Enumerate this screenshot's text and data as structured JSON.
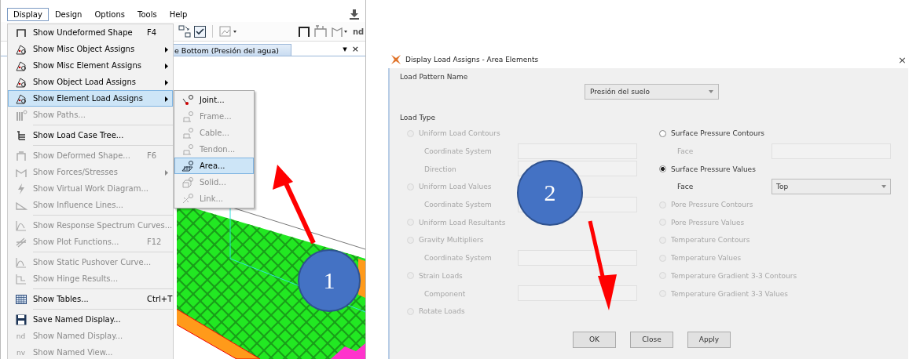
{
  "left_window": {
    "menu_bar": [
      {
        "label": "Display",
        "selected": true
      },
      {
        "label": "Design",
        "selected": false
      },
      {
        "label": "Options",
        "selected": false
      },
      {
        "label": "Tools",
        "selected": false
      },
      {
        "label": "Help",
        "selected": false
      }
    ],
    "toolbar": {
      "text": "nd"
    },
    "tab": {
      "label": "e Bottom (Presión del agua)",
      "menu": "▾",
      "close": "×"
    },
    "display_menu": [
      {
        "kind": "item",
        "label": "Show Undeformed Shape",
        "shortcut": "F4",
        "disabled": false,
        "selected": false,
        "submenu": false
      },
      {
        "kind": "item",
        "label": "Show Misc Object Assigns",
        "disabled": false,
        "selected": false,
        "submenu": true
      },
      {
        "kind": "item",
        "label": "Show Misc Element Assigns",
        "disabled": false,
        "selected": false,
        "submenu": true
      },
      {
        "kind": "item",
        "label": "Show Object Load Assigns",
        "disabled": false,
        "selected": false,
        "submenu": true
      },
      {
        "kind": "item",
        "label": "Show Element Load Assigns",
        "disabled": false,
        "selected": true,
        "submenu": true
      },
      {
        "kind": "item",
        "label": "Show Paths...",
        "disabled": true,
        "selected": false,
        "submenu": false
      },
      {
        "kind": "separator"
      },
      {
        "kind": "item",
        "label": "Show Load Case Tree...",
        "disabled": false,
        "selected": false,
        "submenu": false
      },
      {
        "kind": "separator"
      },
      {
        "kind": "item",
        "label": "Show Deformed Shape...",
        "shortcut": "F6",
        "disabled": true,
        "selected": false,
        "submenu": false
      },
      {
        "kind": "item",
        "label": "Show Forces/Stresses",
        "disabled": true,
        "selected": false,
        "submenu": true
      },
      {
        "kind": "item",
        "label": "Show Virtual Work Diagram...",
        "disabled": true,
        "selected": false,
        "submenu": false
      },
      {
        "kind": "item",
        "label": "Show Influence Lines...",
        "disabled": true,
        "selected": false,
        "submenu": false
      },
      {
        "kind": "separator"
      },
      {
        "kind": "item",
        "label": "Show Response Spectrum Curves...",
        "disabled": true,
        "selected": false,
        "submenu": false
      },
      {
        "kind": "item",
        "label": "Show Plot Functions...",
        "shortcut": "F12",
        "disabled": true,
        "selected": false,
        "submenu": false
      },
      {
        "kind": "separator"
      },
      {
        "kind": "item",
        "label": "Show Static Pushover Curve...",
        "disabled": true,
        "selected": false,
        "submenu": false
      },
      {
        "kind": "item",
        "label": "Show Hinge Results...",
        "disabled": true,
        "selected": false,
        "submenu": false
      },
      {
        "kind": "separator"
      },
      {
        "kind": "item",
        "label": "Show Tables...",
        "shortcut": "Ctrl+T",
        "disabled": false,
        "selected": false,
        "submenu": false
      },
      {
        "kind": "separator"
      },
      {
        "kind": "item",
        "label": "Save Named Display...",
        "disabled": false,
        "selected": false,
        "submenu": false
      },
      {
        "kind": "item",
        "label": "Show Named Display...",
        "icon_text": "nd",
        "disabled": true,
        "selected": false,
        "submenu": false
      },
      {
        "kind": "item",
        "label": "Show Named View...",
        "icon_text": "nv",
        "disabled": true,
        "selected": false,
        "submenu": false
      }
    ],
    "submenu": [
      {
        "label": "Joint...",
        "disabled": false,
        "selected": false
      },
      {
        "label": "Frame...",
        "disabled": true,
        "selected": false
      },
      {
        "label": "Cable...",
        "disabled": true,
        "selected": false
      },
      {
        "label": "Tendon...",
        "disabled": true,
        "selected": false
      },
      {
        "label": "Area...",
        "disabled": false,
        "selected": true
      },
      {
        "label": "Solid...",
        "disabled": true,
        "selected": false
      },
      {
        "label": "Link...",
        "disabled": true,
        "selected": false
      }
    ],
    "callout": {
      "label": "1"
    }
  },
  "dialog": {
    "title": "Display Load Assigns - Area Elements",
    "close": "×",
    "load_pattern_label": "Load Pattern Name",
    "load_pattern": "Presión del suelo",
    "load_type_label": "Load Type",
    "left_column": [
      {
        "kind": "radio",
        "label": "Uniform Load Contours",
        "selected": false,
        "disabled": true
      },
      {
        "kind": "field",
        "label": "Coordinate System",
        "disabled": true
      },
      {
        "kind": "field",
        "label": "Direction",
        "disabled": true
      },
      {
        "kind": "radio",
        "label": "Uniform Load Values",
        "selected": false,
        "disabled": true
      },
      {
        "kind": "field",
        "label": "Coordinate System",
        "disabled": true
      },
      {
        "kind": "radio",
        "label": "Uniform Load Resultants",
        "selected": false,
        "disabled": true
      },
      {
        "kind": "radio",
        "label": "Gravity Multipliers",
        "selected": false,
        "disabled": true
      },
      {
        "kind": "field",
        "label": "Coordinate System",
        "disabled": true
      },
      {
        "kind": "radio",
        "label": "Strain Loads",
        "selected": false,
        "disabled": true
      },
      {
        "kind": "field",
        "label": "Component",
        "disabled": true
      },
      {
        "kind": "radio",
        "label": "Rotate Loads",
        "selected": false,
        "disabled": true
      }
    ],
    "right_column": [
      {
        "kind": "radio",
        "label": "Surface Pressure Contours",
        "selected": false,
        "disabled": false
      },
      {
        "kind": "field",
        "label": "Face",
        "disabled": true
      },
      {
        "kind": "radio",
        "label": "Surface Pressure Values",
        "selected": true,
        "disabled": false
      },
      {
        "kind": "dropdown",
        "label": "Face",
        "value": "Top",
        "disabled": false
      },
      {
        "kind": "radio",
        "label": "Pore Pressure Contours",
        "selected": false,
        "disabled": true
      },
      {
        "kind": "radio",
        "label": "Pore Pressure Values",
        "selected": false,
        "disabled": true
      },
      {
        "kind": "radio",
        "label": "Temperature Contours",
        "selected": false,
        "disabled": true
      },
      {
        "kind": "radio",
        "label": "Temperature Values",
        "selected": false,
        "disabled": true
      },
      {
        "kind": "radio",
        "label": "Temperature Gradient 3-3 Contours",
        "selected": false,
        "disabled": true
      },
      {
        "kind": "radio",
        "label": "Temperature Gradient 3-3 Values",
        "selected": false,
        "disabled": true
      }
    ],
    "buttons": [
      "OK",
      "Close",
      "Apply"
    ],
    "callout": {
      "label": "2"
    }
  }
}
